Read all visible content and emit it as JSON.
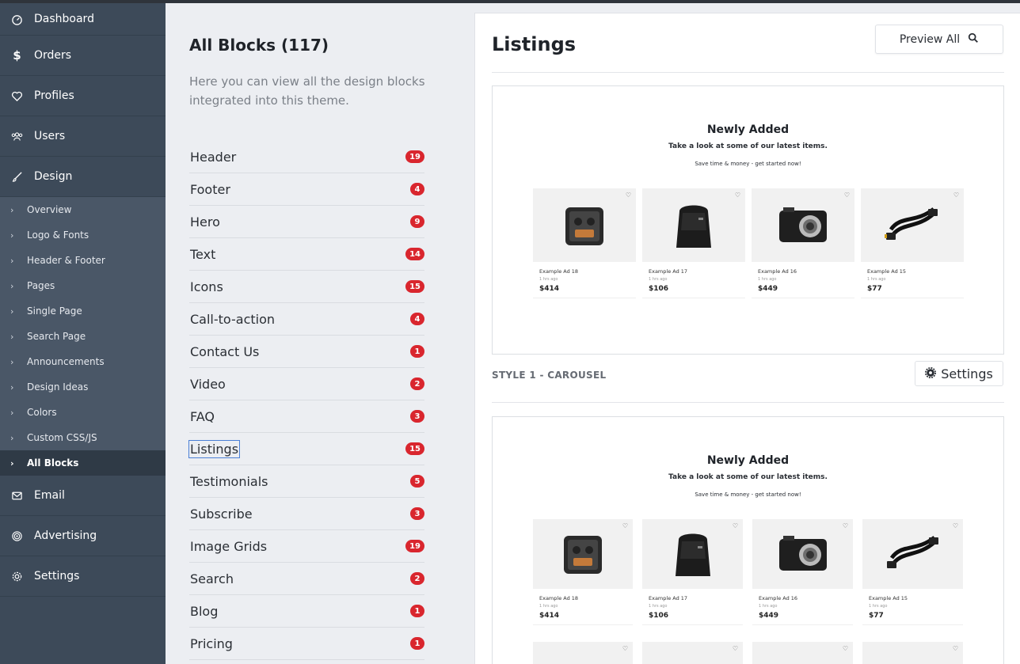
{
  "sidebar": {
    "items_top": [
      {
        "label": "Dashboard",
        "icon": "dashboard-icon"
      },
      {
        "label": "Orders",
        "icon": "dollar-icon"
      },
      {
        "label": "Profiles",
        "icon": "heart-icon"
      },
      {
        "label": "Users",
        "icon": "users-icon"
      },
      {
        "label": "Design",
        "icon": "brush-icon"
      }
    ],
    "design_sub": [
      "Overview",
      "Logo & Fonts",
      "Header & Footer",
      "Pages",
      "Single Page",
      "Search Page",
      "Announcements",
      "Design Ideas",
      "Colors",
      "Custom CSS/JS",
      "All Blocks"
    ],
    "items_bottom": [
      {
        "label": "Email",
        "icon": "mail-icon"
      },
      {
        "label": "Advertising",
        "icon": "target-icon"
      },
      {
        "label": "Settings",
        "icon": "gear-icon"
      }
    ]
  },
  "middle": {
    "title": "All Blocks (117)",
    "description": "Here you can view all the design blocks integrated into this theme.",
    "blocks": [
      {
        "label": "Header",
        "count": "19"
      },
      {
        "label": "Footer",
        "count": "4"
      },
      {
        "label": "Hero",
        "count": "9"
      },
      {
        "label": "Text",
        "count": "14"
      },
      {
        "label": "Icons",
        "count": "15"
      },
      {
        "label": "Call-to-action",
        "count": "4"
      },
      {
        "label": "Contact Us",
        "count": "1"
      },
      {
        "label": "Video",
        "count": "2"
      },
      {
        "label": "FAQ",
        "count": "3"
      },
      {
        "label": "Listings",
        "count": "15"
      },
      {
        "label": "Testimonials",
        "count": "5"
      },
      {
        "label": "Subscribe",
        "count": "3"
      },
      {
        "label": "Image Grids",
        "count": "19"
      },
      {
        "label": "Search",
        "count": "2"
      },
      {
        "label": "Blog",
        "count": "1"
      },
      {
        "label": "Pricing",
        "count": "1"
      }
    ]
  },
  "right": {
    "title": "Listings",
    "preview_all": "Preview All",
    "style_label": "STYLE 1 - CAROUSEL",
    "settings_label": "Settings",
    "preview": {
      "heading": "Newly Added",
      "subheading": "Take a look at some of our latest items.",
      "tagline": "Save time & money - get started now!",
      "cards": [
        {
          "title": "Example Ad 18",
          "ago": "1 hrs ago",
          "price": "$414",
          "icon": "camera-case-icon"
        },
        {
          "title": "Example Ad 17",
          "ago": "1 hrs ago",
          "price": "$106",
          "icon": "camera-bag-icon"
        },
        {
          "title": "Example Ad 16",
          "ago": "1 hrs ago",
          "price": "$449",
          "icon": "camera-icon"
        },
        {
          "title": "Example Ad 15",
          "ago": "1 hrs ago",
          "price": "$77",
          "icon": "hdmi-cable-icon"
        }
      ]
    }
  }
}
